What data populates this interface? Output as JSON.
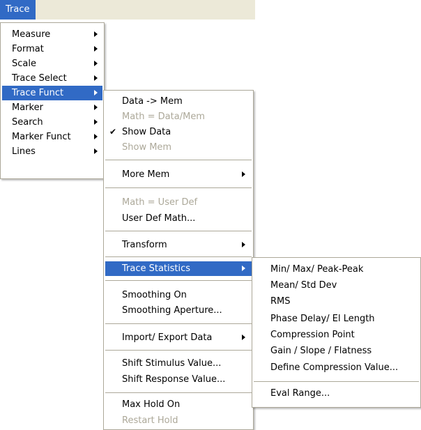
{
  "menubar": {
    "title": "Trace"
  },
  "menu1": {
    "items": [
      {
        "label": "Measure"
      },
      {
        "label": "Format"
      },
      {
        "label": "Scale"
      },
      {
        "label": "Trace Select"
      },
      {
        "label": "Trace Funct"
      },
      {
        "label": "Marker"
      },
      {
        "label": "Search"
      },
      {
        "label": "Marker Funct"
      },
      {
        "label": "Lines"
      }
    ]
  },
  "menu2": {
    "items": [
      {
        "label": "Data -> Mem"
      },
      {
        "label": "Math = Data/Mem"
      },
      {
        "label": "Show Data",
        "check": "✔"
      },
      {
        "label": "Show Mem"
      },
      {
        "label": "More Mem"
      },
      {
        "label": "Math = User Def"
      },
      {
        "label": "User Def Math..."
      },
      {
        "label": "Transform"
      },
      {
        "label": "Trace Statistics"
      },
      {
        "label": "Smoothing On"
      },
      {
        "label": "Smoothing Aperture..."
      },
      {
        "label": "Import/ Export Data"
      },
      {
        "label": "Shift Stimulus Value..."
      },
      {
        "label": "Shift Response Value..."
      },
      {
        "label": "Max Hold On"
      },
      {
        "label": "Restart Hold"
      }
    ]
  },
  "menu3": {
    "items": [
      {
        "label": "Min/ Max/ Peak-Peak"
      },
      {
        "label": "Mean/ Std Dev"
      },
      {
        "label": "RMS"
      },
      {
        "label": "Phase Delay/ El Length"
      },
      {
        "label": "Compression Point"
      },
      {
        "label": "Gain / Slope / Flatness"
      },
      {
        "label": "Define Compression Value..."
      },
      {
        "label": "Eval Range..."
      }
    ]
  }
}
